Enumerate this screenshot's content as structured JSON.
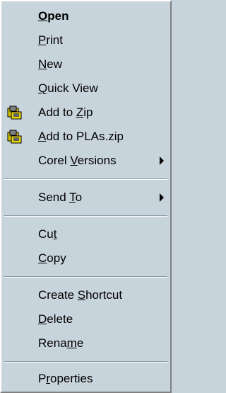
{
  "menu": {
    "items": {
      "open": {
        "pre": "",
        "key": "O",
        "post": "pen"
      },
      "print": {
        "pre": "",
        "key": "P",
        "post": "rint"
      },
      "new": {
        "pre": "",
        "key": "N",
        "post": "ew"
      },
      "quick_view": {
        "pre": "",
        "key": "Q",
        "post": "uick View"
      },
      "add_to_zip": {
        "pre": "Add to ",
        "key": "Z",
        "post": "ip",
        "icon": "winzip-icon"
      },
      "add_to_plas_zip": {
        "pre": "",
        "key": "A",
        "post": "dd to PLAs.zip",
        "icon": "winzip-icon"
      },
      "corel_versions": {
        "pre": "Corel ",
        "key": "V",
        "post": "ersions"
      },
      "send_to": {
        "pre": "Send ",
        "key": "T",
        "post": "o"
      },
      "cut": {
        "pre": "Cu",
        "key": "t",
        "post": ""
      },
      "copy": {
        "pre": "",
        "key": "C",
        "post": "opy"
      },
      "create_shortcut": {
        "pre": "Create ",
        "key": "S",
        "post": "hortcut"
      },
      "delete": {
        "pre": "",
        "key": "D",
        "post": "elete"
      },
      "rename": {
        "pre": "Rena",
        "key": "m",
        "post": "e"
      },
      "properties": {
        "pre": "P",
        "key": "r",
        "post": "operties"
      }
    },
    "submenu_arrow_icon": "triangle-right-icon",
    "colors": {
      "background": "#c8d4dc",
      "text": "#000000"
    }
  }
}
